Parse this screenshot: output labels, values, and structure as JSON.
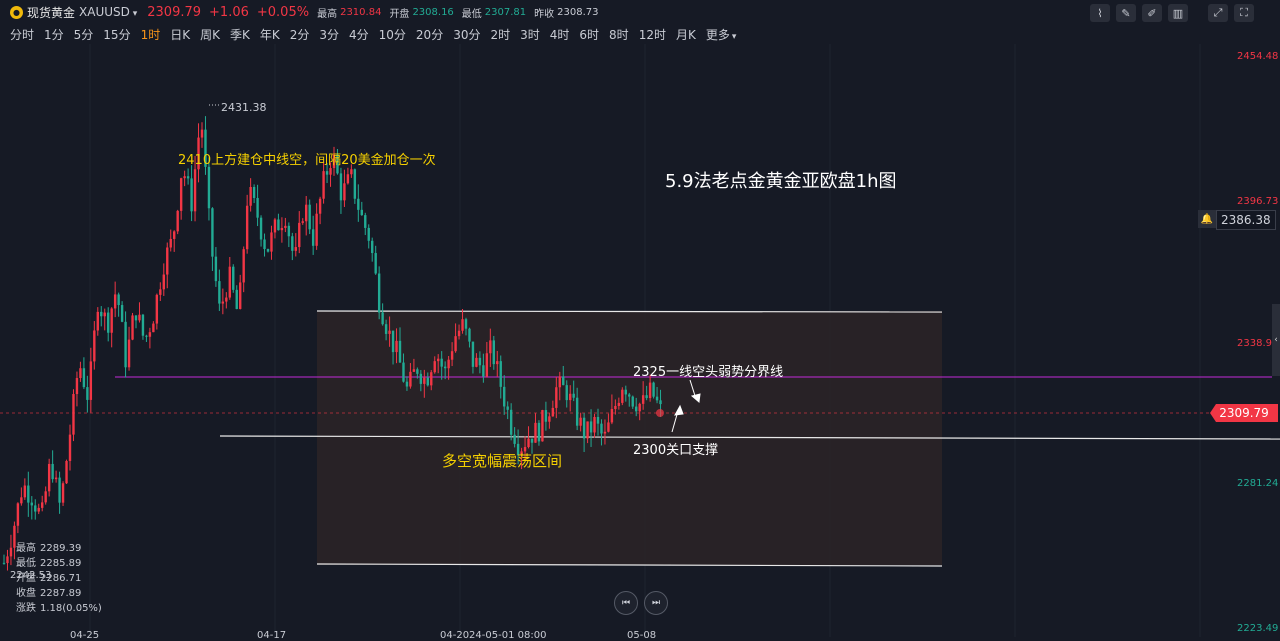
{
  "header": {
    "name": "现货黄金",
    "symbol": "XAUUSD",
    "price": "2309.79",
    "change": "+1.06",
    "change_pct": "+0.05%",
    "high_label": "最高",
    "high": "2310.84",
    "open_label": "开盘",
    "open": "2308.16",
    "low_label": "最低",
    "low": "2307.81",
    "prev_label": "昨收",
    "prev": "2308.73"
  },
  "intervals": [
    "分时",
    "1分",
    "5分",
    "15分",
    "1时",
    "日K",
    "周K",
    "季K",
    "年K",
    "2分",
    "3分",
    "4分",
    "10分",
    "20分",
    "30分",
    "2时",
    "3时",
    "4时",
    "6时",
    "8时",
    "12时",
    "月K",
    "更多"
  ],
  "active_interval": "1时",
  "tool_icons": [
    "indicator-icon",
    "draw-icon",
    "pen-icon",
    "candle-type-icon",
    "expand-icon",
    "fullscreen-icon"
  ],
  "price_axis": [
    "2454.48",
    "2396.73",
    "2338.98",
    "2281.24",
    "2223.49"
  ],
  "annotations": {
    "peak": "2431.38",
    "left_note": "2410上方建仓中线空，间隔20美金加仓一次",
    "title": "5.9法老点金黄金亚欧盘1h图",
    "resistance_note": "2325一线空头弱势分界线",
    "support_note": "2300关口支撑",
    "range_note": "多空宽幅震荡区间",
    "left_low": "2242.53"
  },
  "alert_price": "2386.38",
  "current_price": "2309.79",
  "ohlc": {
    "high_label": "最高",
    "high": "2289.39",
    "low_label": "最低",
    "low": "2285.89",
    "open_label": "开盘",
    "open": "2286.71",
    "close_label": "收盘",
    "close": "2287.89",
    "chg_label": "涨跌",
    "chg": "1.18(0.05%)"
  },
  "date_labels": [
    "04-25",
    "04-17",
    "04-2024-05-01 08:00",
    "05-08"
  ],
  "colors": {
    "up": "#f23645",
    "down": "#22ab94",
    "accent": "#f7931a",
    "resistance_line": "#c22ad8",
    "range_fill": "#2b2427",
    "note_yellow": "#f5d000"
  },
  "chart_data": {
    "type": "candlestick",
    "ylim": [
      2223.49,
      2454.48
    ],
    "price_levels": {
      "resistance": 2325,
      "support": 2300,
      "range_top": 2350,
      "range_bottom": 2252,
      "current": 2309.79
    },
    "close_path": [
      2248,
      2262,
      2280,
      2275,
      2266,
      2290,
      2270,
      2300,
      2330,
      2315,
      2355,
      2345,
      2360,
      2330,
      2352,
      2338,
      2350,
      2370,
      2380,
      2410,
      2395,
      2431,
      2380,
      2350,
      2365,
      2348,
      2400,
      2390,
      2375,
      2385,
      2390,
      2370,
      2395,
      2380,
      2402,
      2415,
      2398,
      2405,
      2390,
      2380,
      2355,
      2342,
      2332,
      2318,
      2328,
      2322,
      2335,
      2325,
      2340,
      2345,
      2330,
      2328,
      2335,
      2320,
      2305,
      2295,
      2300,
      2302,
      2310,
      2320,
      2318,
      2308,
      2300,
      2305,
      2298,
      2310,
      2322,
      2315,
      2312,
      2318,
      2309.79
    ]
  }
}
